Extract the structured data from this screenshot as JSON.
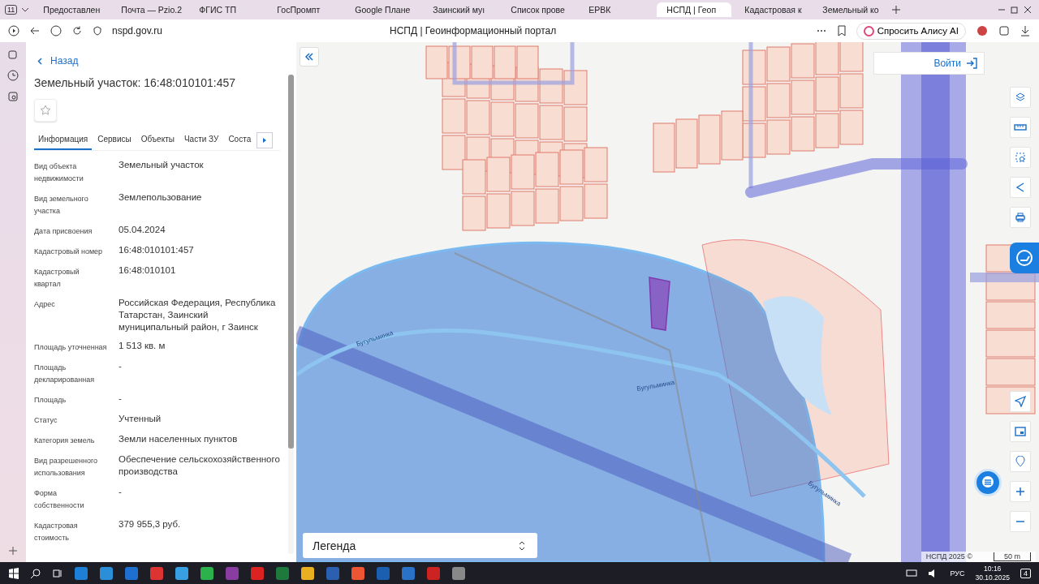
{
  "browser": {
    "tab_count": "11",
    "tabs": [
      {
        "title": "Предоставлен",
        "selected": false
      },
      {
        "title": "Почта — Pzio.2",
        "selected": false
      },
      {
        "title": "ФГИС ТП",
        "selected": false
      },
      {
        "title": "ГосПромпт",
        "selected": false
      },
      {
        "title": "Google Плане",
        "selected": false
      },
      {
        "title": "Заинский муı",
        "selected": false
      },
      {
        "title": "Список прове",
        "selected": false
      },
      {
        "title": "ЕРВК",
        "selected": false
      },
      {
        "title": "НСПД | Геоп",
        "selected": true
      },
      {
        "title": "Кадастровая к",
        "selected": false
      },
      {
        "title": "Земельный ко",
        "selected": false
      }
    ],
    "address": "nspd.gov.ru",
    "page_title": "НСПД | Геоинформационный портал",
    "assistant_button": "Спросить Алису AI"
  },
  "panel": {
    "back": "Назад",
    "title": "Земельный участок: 16:48:010101:457",
    "tabs": [
      {
        "label": "Информация",
        "selected": true
      },
      {
        "label": "Сервисы",
        "selected": false
      },
      {
        "label": "Объекты",
        "selected": false
      },
      {
        "label": "Части ЗУ",
        "selected": false
      },
      {
        "label": "Соста",
        "selected": false
      }
    ],
    "fields": [
      {
        "label": "Вид объекта недвижимости",
        "value": "Земельный участок"
      },
      {
        "label": "Вид земельного участка",
        "value": "Землепользование"
      },
      {
        "label": "Дата присвоения",
        "value": "05.04.2024"
      },
      {
        "label": "Кадастровый номер",
        "value": "16:48:010101:457"
      },
      {
        "label": "Кадастровый квартал",
        "value": "16:48:010101"
      },
      {
        "label": "Адрес",
        "value": "Российская Федерация, Республика Татарстан, Заинский муниципальный район, г Заинск"
      },
      {
        "label": "Площадь уточненная",
        "value": "1 513 кв. м"
      },
      {
        "label": "Площадь декларированная",
        "value": "-"
      },
      {
        "label": "Площадь",
        "value": "-"
      },
      {
        "label": "Статус",
        "value": "Учтенный"
      },
      {
        "label": "Категория земель",
        "value": "Земли населенных пунктов"
      },
      {
        "label": "Вид разрешенного использования",
        "value": "Обеспечение сельскохозяйственного производства"
      },
      {
        "label": "Форма собственности",
        "value": "-"
      },
      {
        "label": "Кадастровая стоимость",
        "value": "379 955,3 руб."
      }
    ]
  },
  "map": {
    "river_labels": [
      "Бугульминка",
      "Бугульминка",
      "Бугульминка"
    ],
    "login": "Войти",
    "legend": "Легенда",
    "attribution": "НСПД 2025 ©",
    "scale": "50 m"
  },
  "taskbar": {
    "language": "РУС",
    "time": "10:16",
    "date": "30.10.2025",
    "notifications": "4"
  }
}
